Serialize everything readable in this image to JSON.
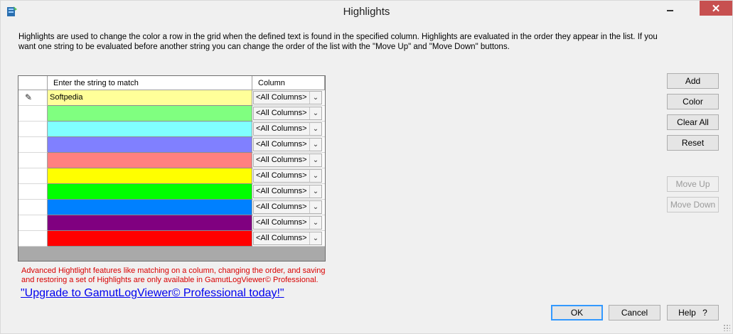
{
  "window": {
    "title": "Highlights",
    "close_glyph": "✕",
    "minimize_icon": "minimize-icon",
    "app_icon": "app-icon"
  },
  "description": "Highlights are used to change the color a row in the grid when the defined text is found in the specified column. Highlights are evaluated in the order they appear in the list. If you want one string to be evaluated before another string you can change the order of the list with the \"Move Up\" and \"Move Down\" buttons.",
  "grid": {
    "headers": {
      "match": "Enter the string to match",
      "column": "Column"
    },
    "edit_marker": "✎",
    "rows": [
      {
        "text": "Softpedia",
        "column": "<All Columns>",
        "color": "#ffff99",
        "editing": true
      },
      {
        "text": "",
        "column": "<All Columns>",
        "color": "#80ff80"
      },
      {
        "text": "",
        "column": "<All Columns>",
        "color": "#80ffff"
      },
      {
        "text": "",
        "column": "<All Columns>",
        "color": "#8080ff"
      },
      {
        "text": "",
        "column": "<All Columns>",
        "color": "#ff8080"
      },
      {
        "text": "",
        "column": "<All Columns>",
        "color": "#ffff00"
      },
      {
        "text": "",
        "column": "<All Columns>",
        "color": "#00ff00"
      },
      {
        "text": "",
        "column": "<All Columns>",
        "color": "#0080ff"
      },
      {
        "text": "",
        "column": "<All Columns>",
        "color": "#800080"
      },
      {
        "text": "",
        "column": "<All Columns>",
        "color": "#ff0000"
      }
    ],
    "dropdown_glyph": "⌄"
  },
  "side_buttons": {
    "add": "Add",
    "color": "Color",
    "clear_all": "Clear All",
    "reset": "Reset",
    "move_up": "Move Up",
    "move_down": "Move Down"
  },
  "advanced_note": "Advanced Hightlight features like matching on a column, changing the order, and saving and restoring a set of Highlights are only available in GamutLogViewer© Professional.",
  "upgrade_link": "\"Upgrade to GamutLogViewer© Professional today!\"",
  "footer_buttons": {
    "ok": "OK",
    "cancel": "Cancel",
    "help": "Help"
  },
  "help_glyph": "?"
}
